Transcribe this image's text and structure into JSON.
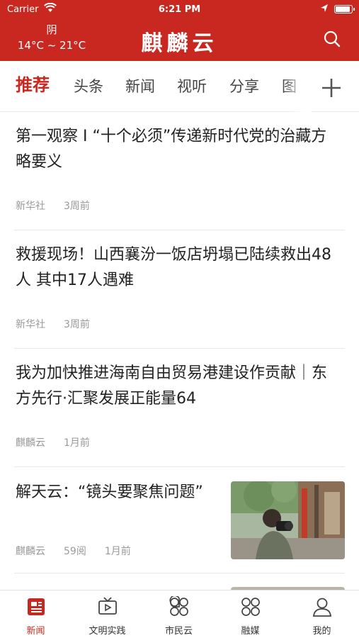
{
  "status_bar": {
    "carrier": "Carrier",
    "time": "6:21 PM"
  },
  "header": {
    "weather": {
      "condition": "阴",
      "temperature": "14°C ~ 21°C"
    },
    "logo_text": "麒麟云",
    "background_color": "#c8281f"
  },
  "tabs": {
    "items": [
      {
        "label": "推荐",
        "active": true
      },
      {
        "label": "头条"
      },
      {
        "label": "新闻"
      },
      {
        "label": "视听"
      },
      {
        "label": "分享"
      },
      {
        "label": "图"
      }
    ],
    "add_icon": "plus-icon"
  },
  "feed": [
    {
      "title": "第一观察 I “十个必须”传递新时代党的治藏方略要义",
      "source": "新华社",
      "time": "3周前"
    },
    {
      "title": "救援现场！山西襄汾一饭店坍塌已陆续救出48人 其中17人遇难",
      "source": "新华社",
      "time": "3周前"
    },
    {
      "title": "我为加快推进海南自由贸易港建设作贡献｜东方先行·汇聚发展正能量64",
      "source": "麒麟云",
      "time": "1月前"
    },
    {
      "title": "解天云：“镜头要聚焦问题”",
      "source": "麒麟云",
      "reads": "59阅",
      "time": "1月前",
      "thumbnail": "photographer-photo"
    }
  ],
  "bottom_nav": [
    {
      "label": "新闻",
      "icon": "news-icon",
      "active": true
    },
    {
      "label": "文明实践",
      "icon": "tv-icon"
    },
    {
      "label": "市民云",
      "icon": "grid-icon"
    },
    {
      "label": "融媒",
      "icon": "grid-icon"
    },
    {
      "label": "我的",
      "icon": "person-icon"
    }
  ],
  "accent_color": "#c8281f"
}
